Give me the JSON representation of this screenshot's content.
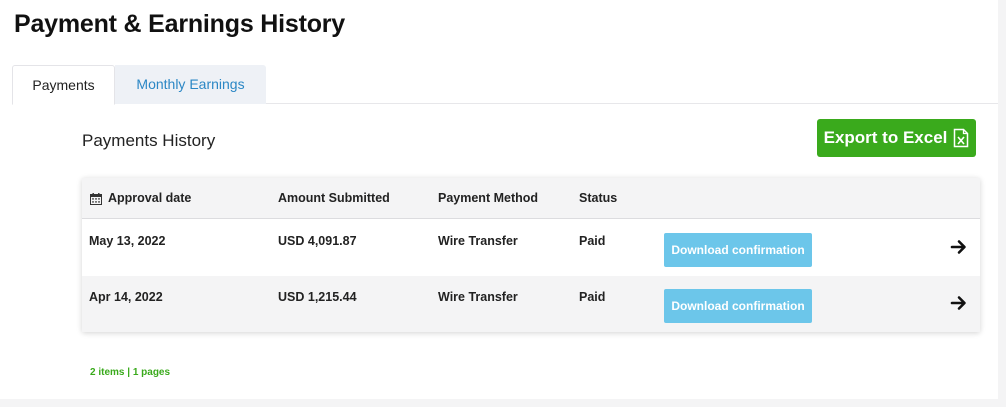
{
  "page": {
    "title": "Payment & Earnings History"
  },
  "tabs": [
    {
      "label": "Payments",
      "active": true
    },
    {
      "label": "Monthly Earnings",
      "active": false
    }
  ],
  "section": {
    "title": "Payments History",
    "export_label": "Export to Excel",
    "export_icon": "excel-file-icon"
  },
  "table": {
    "headers": {
      "date": "Approval date",
      "date_icon": "calendar-icon",
      "amount": "Amount Submitted",
      "method": "Payment Method",
      "status": "Status"
    },
    "rows": [
      {
        "date": "May 13, 2022",
        "amount": "USD 4,091.87",
        "method": "Wire Transfer",
        "status": "Paid",
        "action": "Download confirmation"
      },
      {
        "date": "Apr 14, 2022",
        "amount": "USD 1,215.44",
        "method": "Wire Transfer",
        "status": "Paid",
        "action": "Download confirmation"
      }
    ]
  },
  "pagination": {
    "summary": "2 items | 1 pages"
  },
  "colors": {
    "accent_green": "#3aaa1c",
    "link_blue": "#2b87c5",
    "button_light_blue": "#6cc6ea"
  }
}
